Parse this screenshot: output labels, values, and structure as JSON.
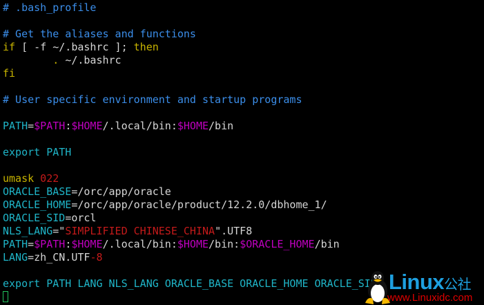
{
  "editor": {
    "lines": [
      [
        {
          "t": "# .bash_profile",
          "c": "comment"
        }
      ],
      [],
      [
        {
          "t": "# Get the aliases and functions",
          "c": "comment"
        }
      ],
      [
        {
          "t": "if",
          "c": "kw"
        },
        {
          "t": " [ -f ~/.bashrc ]; ",
          "c": "txt"
        },
        {
          "t": "then",
          "c": "kw"
        }
      ],
      [
        {
          "t": "        . ",
          "c": "kw"
        },
        {
          "t": "~/.bashrc",
          "c": "txt"
        }
      ],
      [
        {
          "t": "fi",
          "c": "kw"
        }
      ],
      [],
      [
        {
          "t": "# User specific environment and startup programs",
          "c": "comment"
        }
      ],
      [],
      [
        {
          "t": "PATH",
          "c": "var"
        },
        {
          "t": "=",
          "c": "txt"
        },
        {
          "t": "$PATH",
          "c": "mag"
        },
        {
          "t": ":",
          "c": "txt"
        },
        {
          "t": "$HOME",
          "c": "mag"
        },
        {
          "t": "/.local/bin:",
          "c": "txt"
        },
        {
          "t": "$HOME",
          "c": "mag"
        },
        {
          "t": "/bin",
          "c": "txt"
        }
      ],
      [],
      [
        {
          "t": "export PATH",
          "c": "var"
        }
      ],
      [],
      [
        {
          "t": "umask",
          "c": "kw"
        },
        {
          "t": " 022",
          "c": "red"
        }
      ],
      [
        {
          "t": "ORACLE_BASE",
          "c": "var"
        },
        {
          "t": "=/orc/app/oracle",
          "c": "txt"
        }
      ],
      [
        {
          "t": "ORACLE_HOME",
          "c": "var"
        },
        {
          "t": "=/orc/app/oracle/product/12.2.0/dbhome_1/",
          "c": "txt"
        }
      ],
      [
        {
          "t": "ORACLE_SID",
          "c": "var"
        },
        {
          "t": "=orcl",
          "c": "txt"
        }
      ],
      [
        {
          "t": "NLS_LANG",
          "c": "var"
        },
        {
          "t": "=\"",
          "c": "txt"
        },
        {
          "t": "SIMPLIFIED CHINESE_CHINA",
          "c": "red"
        },
        {
          "t": "\".UTF8",
          "c": "txt"
        }
      ],
      [
        {
          "t": "PATH",
          "c": "var"
        },
        {
          "t": "=",
          "c": "txt"
        },
        {
          "t": "$PATH",
          "c": "mag"
        },
        {
          "t": ":",
          "c": "txt"
        },
        {
          "t": "$HOME",
          "c": "mag"
        },
        {
          "t": "/.local/bin:",
          "c": "txt"
        },
        {
          "t": "$HOME",
          "c": "mag"
        },
        {
          "t": "/bin:",
          "c": "txt"
        },
        {
          "t": "$ORACLE_HOME",
          "c": "mag"
        },
        {
          "t": "/bin",
          "c": "txt"
        }
      ],
      [
        {
          "t": "LANG",
          "c": "var"
        },
        {
          "t": "=zh_CN.UTF",
          "c": "txt"
        },
        {
          "t": "-8",
          "c": "red"
        }
      ],
      [],
      [
        {
          "t": "export PATH LANG NLS_LANG ORACLE_BASE ORACLE_HOME ORACLE_SID",
          "c": "var"
        }
      ]
    ]
  },
  "watermark": {
    "brand": "Linux",
    "brand_cn": "公社",
    "url": "www.Linuxidc.com"
  },
  "colors": {
    "comment": "#3b8eea",
    "keyword": "#c8b400",
    "variable": "#1fb5c8",
    "expansion": "#c000c0",
    "string": "#c41a1a",
    "cursor": "#22c55e"
  }
}
